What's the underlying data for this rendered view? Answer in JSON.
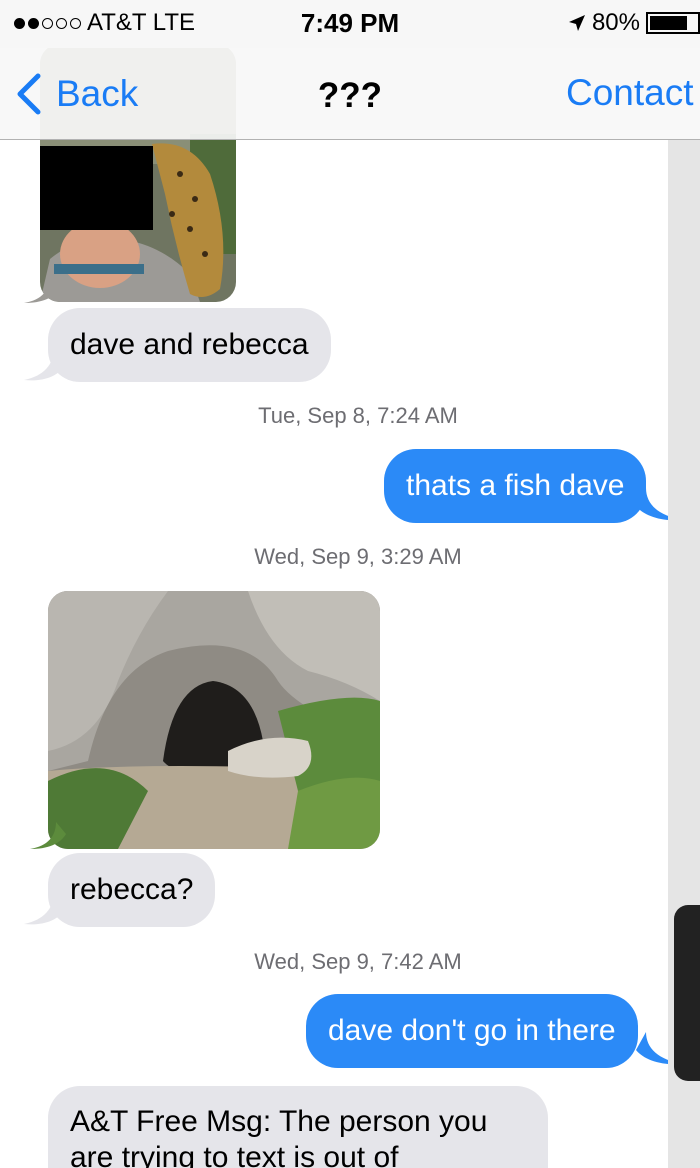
{
  "status_bar": {
    "signal_dots_filled": 2,
    "signal_dots_total": 5,
    "carrier": "AT&T LTE",
    "time": "7:49 PM",
    "battery": "80%",
    "battery_level": 0.8,
    "location_icon": "location-arrow-icon"
  },
  "nav": {
    "back_label": "Back",
    "title": "???",
    "right_label": "Contact"
  },
  "thread": [
    {
      "type": "photo",
      "direction": "incoming",
      "description_icon": "photo-fish"
    },
    {
      "type": "text",
      "direction": "incoming",
      "text": "dave and rebecca"
    },
    {
      "type": "timestamp",
      "text": "Tue, Sep 8, 7:24 AM"
    },
    {
      "type": "text",
      "direction": "outgoing",
      "text": "thats a fish dave"
    },
    {
      "type": "timestamp",
      "text": "Wed, Sep 9, 3:29 AM"
    },
    {
      "type": "photo",
      "direction": "incoming",
      "description_icon": "photo-cave"
    },
    {
      "type": "text",
      "direction": "incoming",
      "text": "rebecca?"
    },
    {
      "type": "timestamp",
      "text": "Wed, Sep 9, 7:42 AM"
    },
    {
      "type": "text",
      "direction": "outgoing",
      "text": "dave don't go in there"
    },
    {
      "type": "text",
      "direction": "incoming",
      "lines": [
        "A&T Free Msg: The person you",
        "are trying to text is out of"
      ]
    }
  ],
  "colors": {
    "ios_blue": "#1a7cf5",
    "outgoing_bubble": "#2b8af7",
    "incoming_bubble": "#e5e5ea",
    "timestamp_text": "#6d6d72"
  }
}
